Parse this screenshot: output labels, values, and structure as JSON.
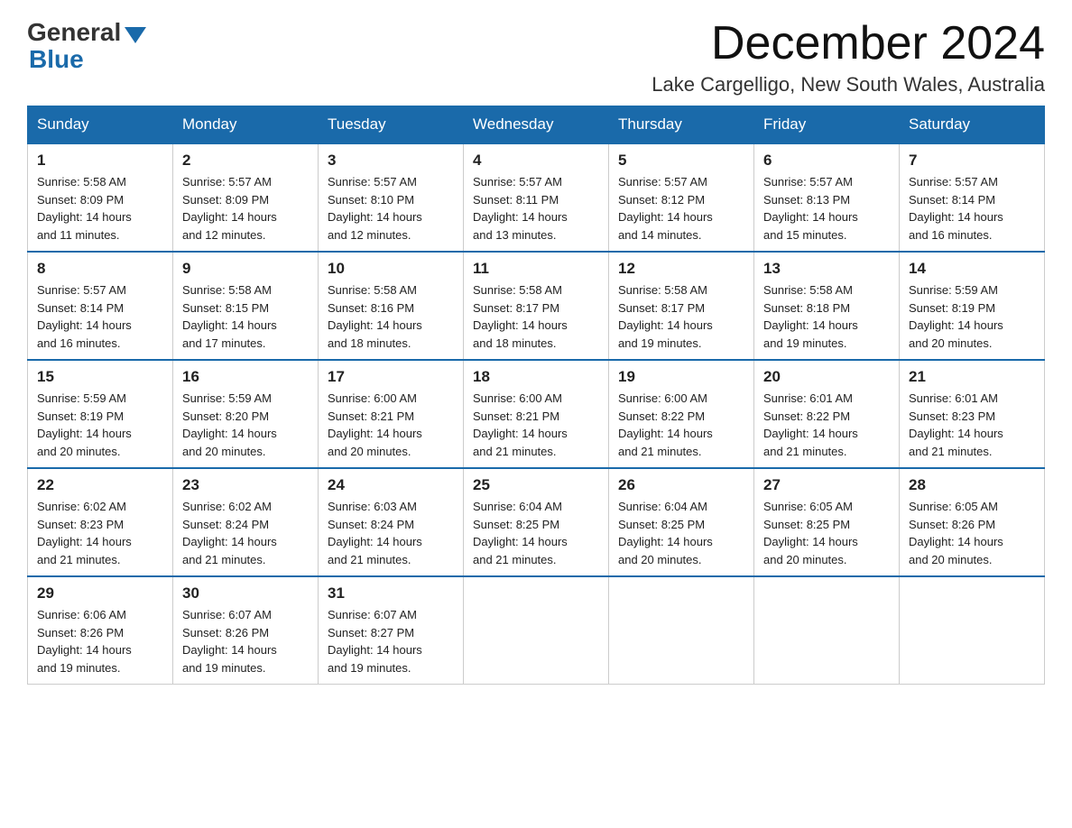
{
  "logo": {
    "general": "General",
    "blue": "Blue"
  },
  "header": {
    "month_year": "December 2024",
    "location": "Lake Cargelligo, New South Wales, Australia"
  },
  "weekdays": [
    "Sunday",
    "Monday",
    "Tuesday",
    "Wednesday",
    "Thursday",
    "Friday",
    "Saturday"
  ],
  "weeks": [
    [
      {
        "day": "1",
        "sunrise": "5:58 AM",
        "sunset": "8:09 PM",
        "daylight": "14 hours and 11 minutes."
      },
      {
        "day": "2",
        "sunrise": "5:57 AM",
        "sunset": "8:09 PM",
        "daylight": "14 hours and 12 minutes."
      },
      {
        "day": "3",
        "sunrise": "5:57 AM",
        "sunset": "8:10 PM",
        "daylight": "14 hours and 12 minutes."
      },
      {
        "day": "4",
        "sunrise": "5:57 AM",
        "sunset": "8:11 PM",
        "daylight": "14 hours and 13 minutes."
      },
      {
        "day": "5",
        "sunrise": "5:57 AM",
        "sunset": "8:12 PM",
        "daylight": "14 hours and 14 minutes."
      },
      {
        "day": "6",
        "sunrise": "5:57 AM",
        "sunset": "8:13 PM",
        "daylight": "14 hours and 15 minutes."
      },
      {
        "day": "7",
        "sunrise": "5:57 AM",
        "sunset": "8:14 PM",
        "daylight": "14 hours and 16 minutes."
      }
    ],
    [
      {
        "day": "8",
        "sunrise": "5:57 AM",
        "sunset": "8:14 PM",
        "daylight": "14 hours and 16 minutes."
      },
      {
        "day": "9",
        "sunrise": "5:58 AM",
        "sunset": "8:15 PM",
        "daylight": "14 hours and 17 minutes."
      },
      {
        "day": "10",
        "sunrise": "5:58 AM",
        "sunset": "8:16 PM",
        "daylight": "14 hours and 18 minutes."
      },
      {
        "day": "11",
        "sunrise": "5:58 AM",
        "sunset": "8:17 PM",
        "daylight": "14 hours and 18 minutes."
      },
      {
        "day": "12",
        "sunrise": "5:58 AM",
        "sunset": "8:17 PM",
        "daylight": "14 hours and 19 minutes."
      },
      {
        "day": "13",
        "sunrise": "5:58 AM",
        "sunset": "8:18 PM",
        "daylight": "14 hours and 19 minutes."
      },
      {
        "day": "14",
        "sunrise": "5:59 AM",
        "sunset": "8:19 PM",
        "daylight": "14 hours and 20 minutes."
      }
    ],
    [
      {
        "day": "15",
        "sunrise": "5:59 AM",
        "sunset": "8:19 PM",
        "daylight": "14 hours and 20 minutes."
      },
      {
        "day": "16",
        "sunrise": "5:59 AM",
        "sunset": "8:20 PM",
        "daylight": "14 hours and 20 minutes."
      },
      {
        "day": "17",
        "sunrise": "6:00 AM",
        "sunset": "8:21 PM",
        "daylight": "14 hours and 20 minutes."
      },
      {
        "day": "18",
        "sunrise": "6:00 AM",
        "sunset": "8:21 PM",
        "daylight": "14 hours and 21 minutes."
      },
      {
        "day": "19",
        "sunrise": "6:00 AM",
        "sunset": "8:22 PM",
        "daylight": "14 hours and 21 minutes."
      },
      {
        "day": "20",
        "sunrise": "6:01 AM",
        "sunset": "8:22 PM",
        "daylight": "14 hours and 21 minutes."
      },
      {
        "day": "21",
        "sunrise": "6:01 AM",
        "sunset": "8:23 PM",
        "daylight": "14 hours and 21 minutes."
      }
    ],
    [
      {
        "day": "22",
        "sunrise": "6:02 AM",
        "sunset": "8:23 PM",
        "daylight": "14 hours and 21 minutes."
      },
      {
        "day": "23",
        "sunrise": "6:02 AM",
        "sunset": "8:24 PM",
        "daylight": "14 hours and 21 minutes."
      },
      {
        "day": "24",
        "sunrise": "6:03 AM",
        "sunset": "8:24 PM",
        "daylight": "14 hours and 21 minutes."
      },
      {
        "day": "25",
        "sunrise": "6:04 AM",
        "sunset": "8:25 PM",
        "daylight": "14 hours and 21 minutes."
      },
      {
        "day": "26",
        "sunrise": "6:04 AM",
        "sunset": "8:25 PM",
        "daylight": "14 hours and 20 minutes."
      },
      {
        "day": "27",
        "sunrise": "6:05 AM",
        "sunset": "8:25 PM",
        "daylight": "14 hours and 20 minutes."
      },
      {
        "day": "28",
        "sunrise": "6:05 AM",
        "sunset": "8:26 PM",
        "daylight": "14 hours and 20 minutes."
      }
    ],
    [
      {
        "day": "29",
        "sunrise": "6:06 AM",
        "sunset": "8:26 PM",
        "daylight": "14 hours and 19 minutes."
      },
      {
        "day": "30",
        "sunrise": "6:07 AM",
        "sunset": "8:26 PM",
        "daylight": "14 hours and 19 minutes."
      },
      {
        "day": "31",
        "sunrise": "6:07 AM",
        "sunset": "8:27 PM",
        "daylight": "14 hours and 19 minutes."
      },
      null,
      null,
      null,
      null
    ]
  ]
}
